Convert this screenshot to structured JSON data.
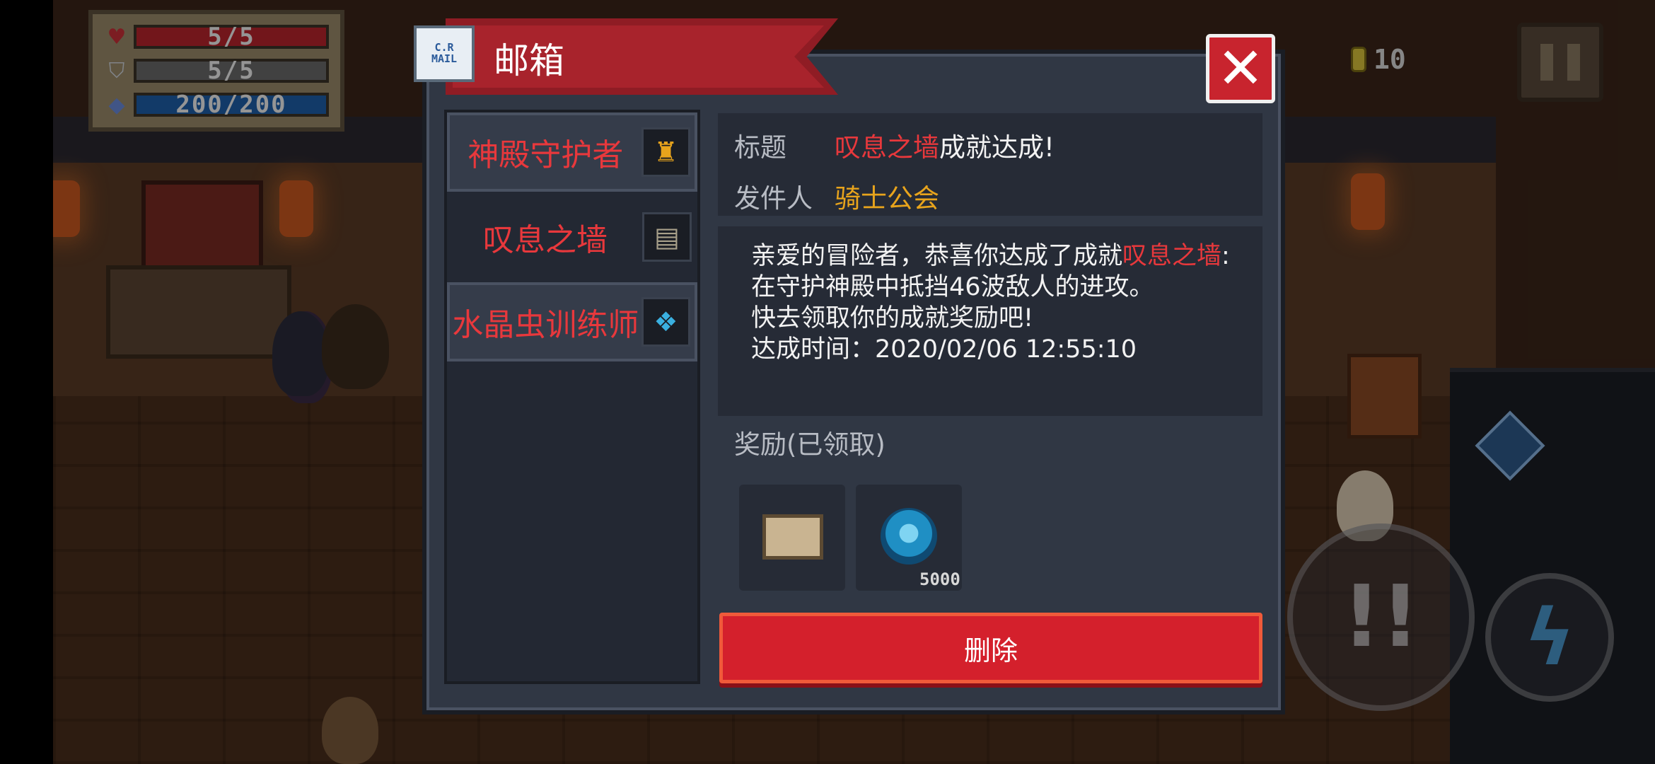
{
  "hud": {
    "hp": "5/5",
    "armor": "5/5",
    "energy": "200/200",
    "coins": "10",
    "colors": {
      "hp": "#b8242c",
      "armor": "#6a6a6a",
      "energy": "#1e5ea8"
    }
  },
  "mailbox": {
    "title": "邮箱",
    "icon_text_top": "C.R",
    "icon_text_bottom": "MAIL",
    "mails": [
      {
        "name": "神殿守护者",
        "icon": "temple-guardian-icon"
      },
      {
        "name": "叹息之墙",
        "icon": "wall-icon"
      },
      {
        "name": "水晶虫训练师",
        "icon": "crystal-bug-icon"
      }
    ],
    "selected_index": 1,
    "detail": {
      "subject_label": "标题",
      "subject_highlight": "叹息之墙",
      "subject_rest": "成就达成!",
      "sender_label": "发件人",
      "sender": "骑士公会",
      "body_intro": "亲爱的冒险者，恭喜你达成了成就",
      "body_highlight": "叹息之墙",
      "body_rest": ":在守护神殿中抵挡46波敌人的进攻。",
      "body_line2": "快去领取你的成就奖励吧!",
      "body_line3": "达成时间：2020/02/06 12:55:10"
    },
    "reward_label": "奖励(已领取)",
    "rewards": [
      {
        "icon": "scroll-icon",
        "quantity": ""
      },
      {
        "icon": "gem-icon",
        "quantity": "5000"
      }
    ],
    "delete_label": "删除"
  }
}
